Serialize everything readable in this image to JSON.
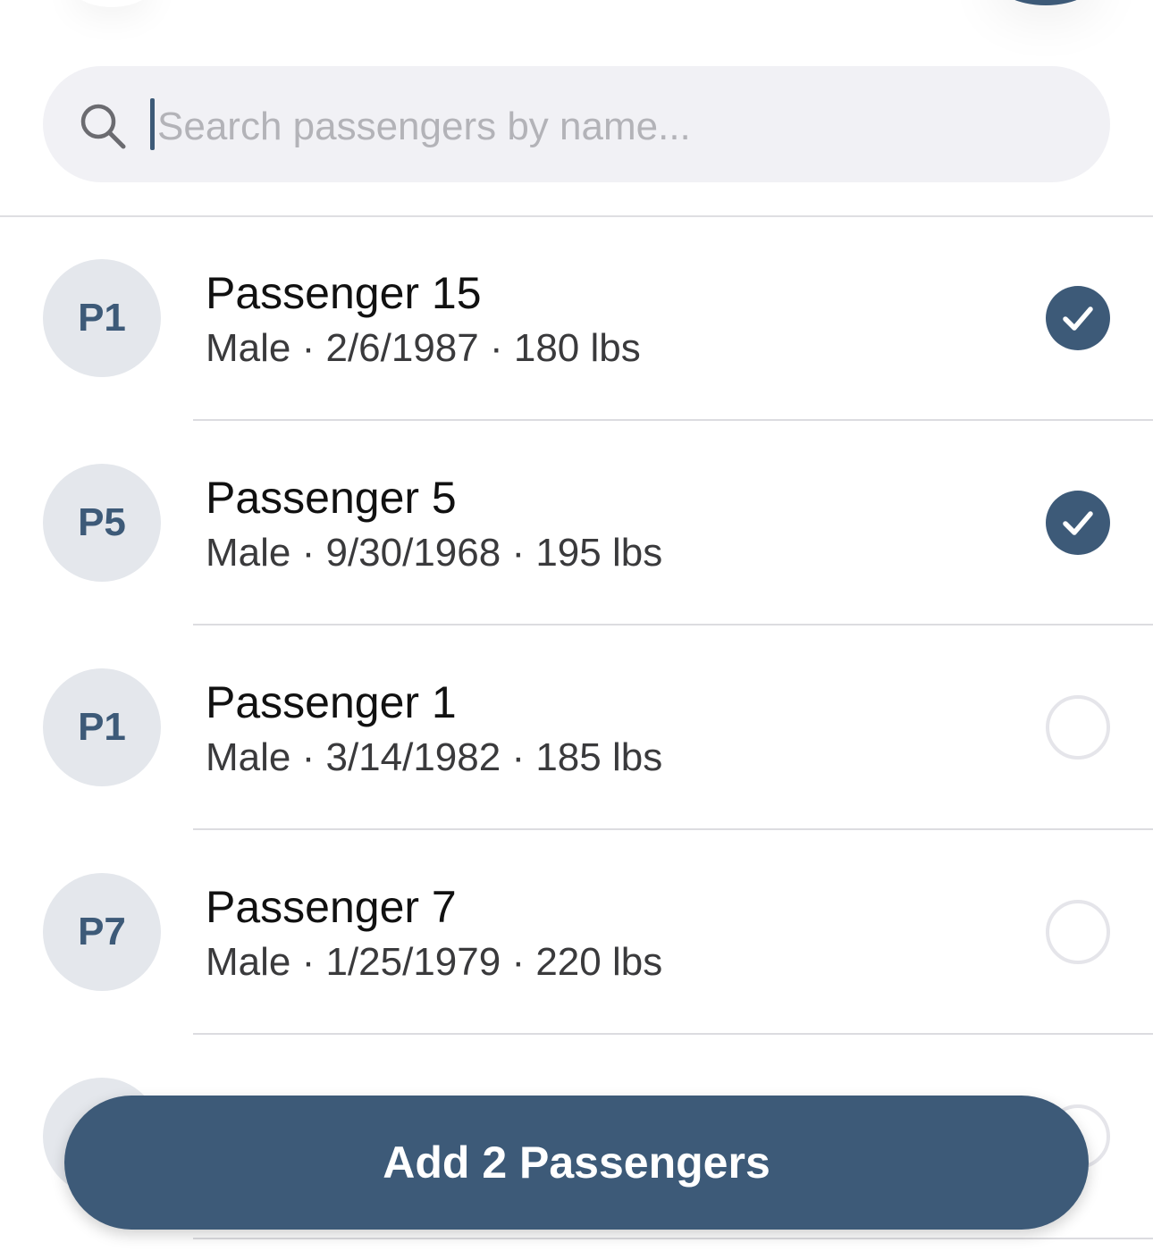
{
  "search": {
    "placeholder": "Search passengers by name...",
    "value": ""
  },
  "passengers": [
    {
      "initials": "P1",
      "name": "Passenger 15",
      "details": "Male · 2/6/1987 · 180 lbs",
      "selected": true
    },
    {
      "initials": "P5",
      "name": "Passenger 5",
      "details": "Male · 9/30/1968 · 195 lbs",
      "selected": true
    },
    {
      "initials": "P1",
      "name": "Passenger 1",
      "details": "Male · 3/14/1982 · 185 lbs",
      "selected": false
    },
    {
      "initials": "P7",
      "name": "Passenger 7",
      "details": "Male · 1/25/1979 · 220 lbs",
      "selected": false
    },
    {
      "initials": "",
      "name": "",
      "details": "",
      "selected": false
    }
  ],
  "footer": {
    "add_button_label": "Add 2 Passengers"
  },
  "colors": {
    "accent": "#3d5a78",
    "avatar_bg": "#e4e7ec",
    "search_bg": "#f1f1f5"
  }
}
